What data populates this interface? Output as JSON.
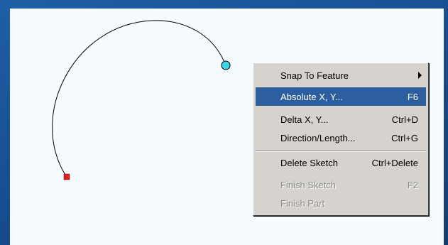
{
  "context_menu": {
    "items": [
      {
        "label": "Snap To Feature",
        "shortcut": "",
        "submenu": true,
        "state": "normal"
      },
      {
        "label": "Absolute X, Y...",
        "shortcut": "F6",
        "submenu": false,
        "state": "highlighted"
      },
      {
        "label": "Delta X, Y...",
        "shortcut": "Ctrl+D",
        "submenu": false,
        "state": "normal"
      },
      {
        "label": "Direction/Length...",
        "shortcut": "Ctrl+G",
        "submenu": false,
        "state": "normal"
      },
      {
        "label": "Delete Sketch",
        "shortcut": "Ctrl+Delete",
        "submenu": false,
        "state": "normal"
      },
      {
        "label": "Finish Sketch",
        "shortcut": "F2",
        "submenu": false,
        "state": "disabled"
      },
      {
        "label": "Finish Part",
        "shortcut": "",
        "submenu": false,
        "state": "disabled"
      }
    ]
  },
  "colors": {
    "highlight": "#2d5f9e",
    "start_vertex": "#e02020",
    "end_vertex": "#3ad6e6",
    "background_blue": "#1f5fa6"
  },
  "icons": {
    "start_vertex": "red-square-vertex",
    "end_vertex": "cyan-circle-vertex"
  }
}
